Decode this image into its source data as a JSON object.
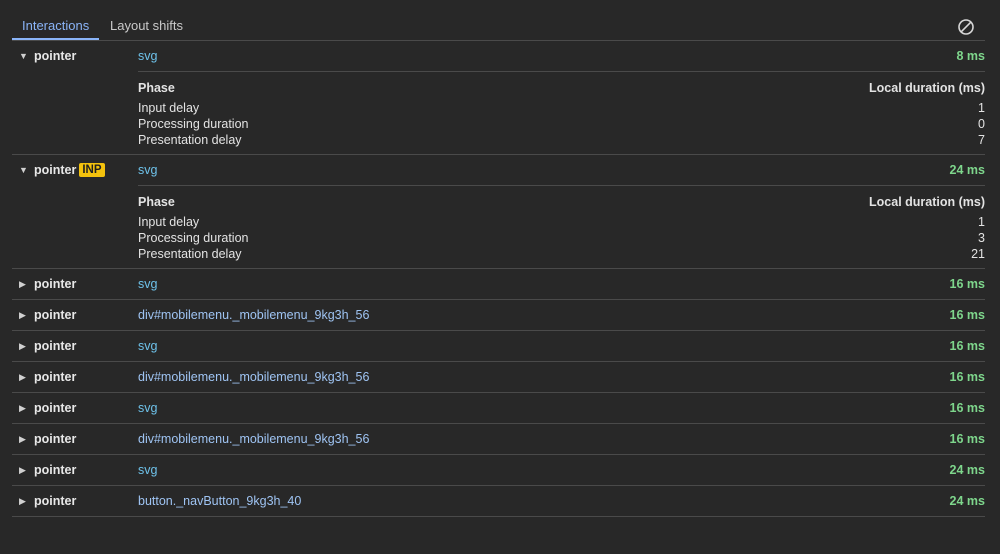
{
  "tabs": {
    "interactions": "Interactions",
    "layout_shifts": "Layout shifts"
  },
  "clear_icon": "clear-circle-slash-icon",
  "phase_header": {
    "name": "Phase",
    "value": "Local duration (ms)"
  },
  "interactions": [
    {
      "expanded": true,
      "type": "pointer",
      "badge": "",
      "target": "svg",
      "duration": "8 ms",
      "phases": [
        {
          "name": "Input delay",
          "value": "1"
        },
        {
          "name": "Processing duration",
          "value": "0"
        },
        {
          "name": "Presentation delay",
          "value": "7"
        }
      ]
    },
    {
      "expanded": true,
      "type": "pointer",
      "badge": "INP",
      "target": "svg",
      "duration": "24 ms",
      "phases": [
        {
          "name": "Input delay",
          "value": "1"
        },
        {
          "name": "Processing duration",
          "value": "3"
        },
        {
          "name": "Presentation delay",
          "value": "21"
        }
      ]
    },
    {
      "expanded": false,
      "type": "pointer",
      "badge": "",
      "target": "svg",
      "duration": "16 ms"
    },
    {
      "expanded": false,
      "type": "pointer",
      "badge": "",
      "target": "div#mobilemenu._mobilemenu_9kg3h_56",
      "duration": "16 ms"
    },
    {
      "expanded": false,
      "type": "pointer",
      "badge": "",
      "target": "svg",
      "duration": "16 ms"
    },
    {
      "expanded": false,
      "type": "pointer",
      "badge": "",
      "target": "div#mobilemenu._mobilemenu_9kg3h_56",
      "duration": "16 ms"
    },
    {
      "expanded": false,
      "type": "pointer",
      "badge": "",
      "target": "svg",
      "duration": "16 ms"
    },
    {
      "expanded": false,
      "type": "pointer",
      "badge": "",
      "target": "div#mobilemenu._mobilemenu_9kg3h_56",
      "duration": "16 ms"
    },
    {
      "expanded": false,
      "type": "pointer",
      "badge": "",
      "target": "svg",
      "duration": "24 ms"
    },
    {
      "expanded": false,
      "type": "pointer",
      "badge": "",
      "target": "button._navButton_9kg3h_40",
      "duration": "24 ms"
    }
  ]
}
